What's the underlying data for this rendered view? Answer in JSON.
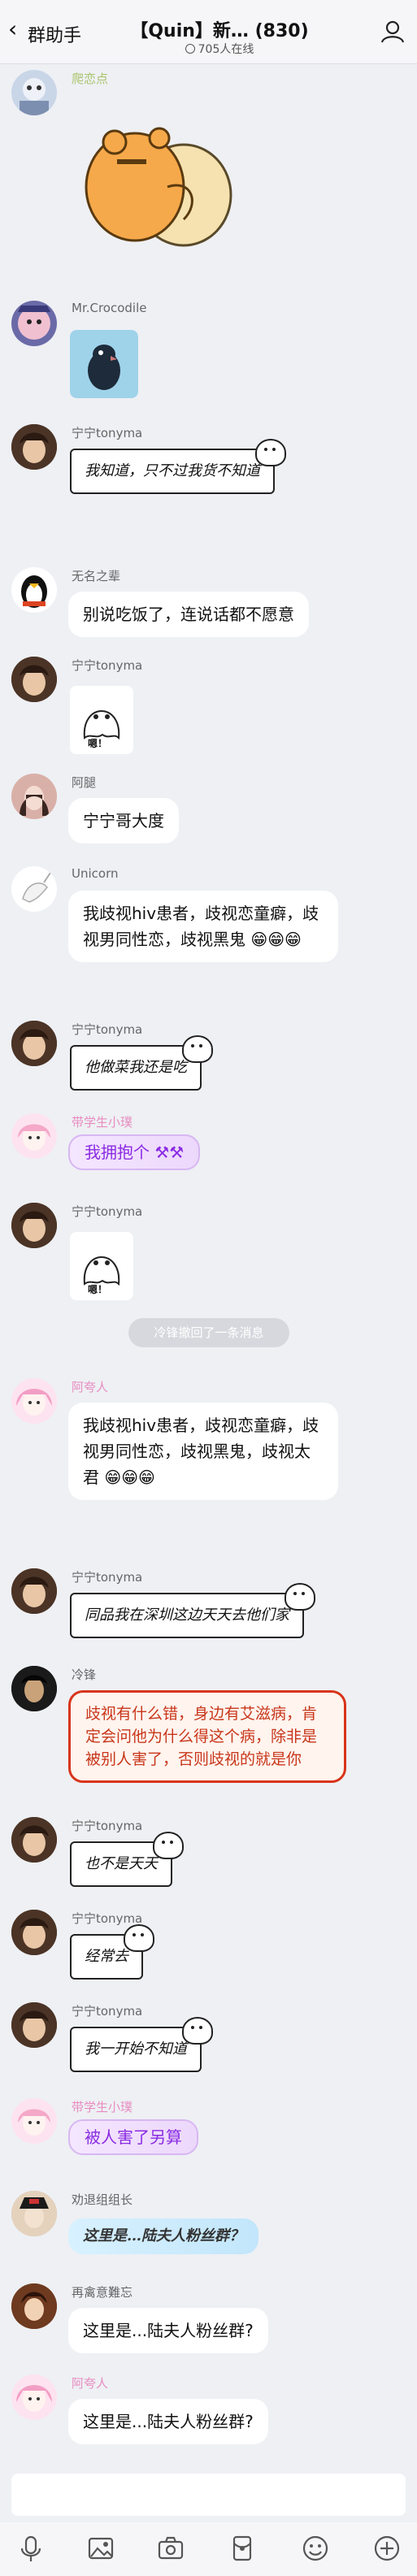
{
  "header": {
    "back_label": "群助手",
    "title": "【Quin】新… (830)",
    "online": "705人在线"
  },
  "messages": [
    {
      "nick": "爬恋点"
    },
    {
      "nick": "Mr.Crocodile"
    },
    {
      "nick": "宁宁tonyma",
      "text": "我知道，只不过我货不知道"
    },
    {
      "nick": "无名之辈",
      "text": "别说吃饭了，连说话都不愿意"
    },
    {
      "nick": "宁宁tonyma",
      "sticker_text": "嗯！"
    },
    {
      "nick": "阿腿",
      "text": "宁宁哥大度"
    },
    {
      "nick": "Unicorn",
      "text": "我歧视hiv患者，歧视恋童癖，歧视男同性恋，歧视黑鬼"
    },
    {
      "nick": "宁宁tonyma",
      "text": "他做菜我还是吃"
    },
    {
      "nick": "带学生小璞",
      "text": "我拥抱个"
    },
    {
      "nick": "宁宁tonyma",
      "sticker_text": "嗯！"
    },
    {
      "recall": "冷锋撤回了一条消息"
    },
    {
      "nick": "阿夸人",
      "text": "我歧视hiv患者，歧视恋童癖，歧视男同性恋，歧视黑鬼，歧视太君"
    },
    {
      "nick": "宁宁tonyma",
      "text": "同品我在深圳这边天天去他们家"
    },
    {
      "nick": "冷锋",
      "text": "歧视有什么错，身边有艾滋病，肯定会问他为什么得这个病，除非是被别人害了，否则歧视的就是你"
    },
    {
      "nick": "宁宁tonyma",
      "text": "也不是天天"
    },
    {
      "nick": "宁宁tonyma",
      "text": "经常去"
    },
    {
      "nick": "宁宁tonyma",
      "text": "我一开始不知道"
    },
    {
      "nick": "带学生小璞",
      "text": "被人害了另算"
    },
    {
      "nick": "劝退组组长",
      "text": "这里是…陆夫人粉丝群？"
    },
    {
      "nick": "再禽意難忘",
      "text": "这里是...陆夫人粉丝群?"
    },
    {
      "nick": "阿夸人",
      "text": "这里是...陆夫人粉丝群?"
    }
  ],
  "colors": {
    "accent_red": "#d8341a",
    "nick_pink": "#e88cc0",
    "bubble": "#ffffff",
    "bg": "#eef0f4"
  },
  "toolbar": [
    "mic-icon",
    "image-icon",
    "camera-icon",
    "red-packet-icon",
    "emoji-icon",
    "plus-icon"
  ]
}
